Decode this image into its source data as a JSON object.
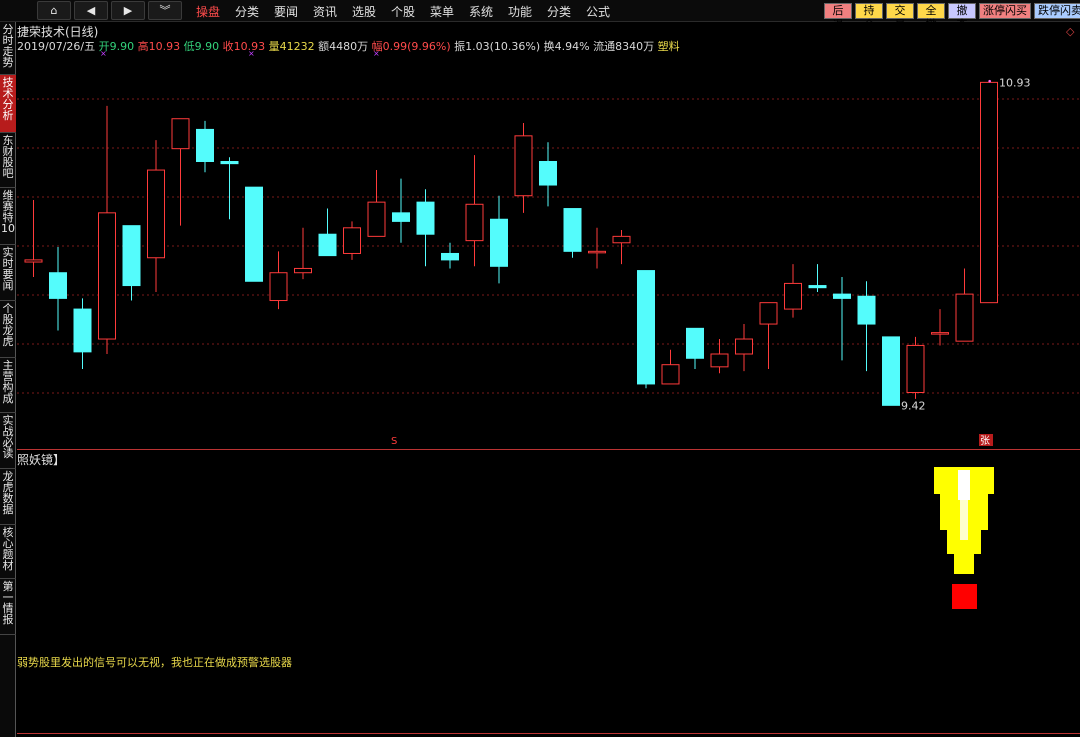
{
  "toolbar": {
    "nav_buttons": [
      {
        "name": "home",
        "glyph": "⌂"
      },
      {
        "name": "back",
        "glyph": "◀"
      },
      {
        "name": "forward",
        "glyph": "▶"
      },
      {
        "name": "expand",
        "glyph": "︾"
      }
    ],
    "menu": [
      "操盘",
      "分类",
      "要闻",
      "资讯",
      "选股",
      "个股",
      "菜单",
      "系统",
      "功能",
      "分类",
      "公式"
    ],
    "active_menu": 0,
    "actions": [
      {
        "label": "后退",
        "color": "#f08080"
      },
      {
        "label": "持仓",
        "color": "#ffd84a"
      },
      {
        "label": "交易",
        "color": "#ffd84a"
      },
      {
        "label": "全撤",
        "color": "#ffd84a"
      },
      {
        "label": "撤查",
        "color": "#c8c8ff"
      },
      {
        "label": "涨停闪买",
        "color": "#f08080"
      },
      {
        "label": "跌停闪卖",
        "color": "#aaccff"
      }
    ]
  },
  "side_tabs": [
    {
      "label": "分时走势",
      "active": false
    },
    {
      "label": "技术分析",
      "active": true
    },
    {
      "label": "东财股吧",
      "active": false
    },
    {
      "label": "维赛特10",
      "active": false
    },
    {
      "label": "实时要闻",
      "active": false
    },
    {
      "label": "个股龙虎",
      "active": false
    },
    {
      "label": "主营构成",
      "active": false
    },
    {
      "label": "实战必读",
      "active": false
    },
    {
      "label": "龙虎数据",
      "active": false
    },
    {
      "label": "核心题材",
      "active": false
    },
    {
      "label": "第一情报",
      "active": false
    }
  ],
  "info": {
    "title": "捷荣技术(日线)",
    "date": "2019/07/26/五",
    "open_label": "开",
    "open": "9.90",
    "high_label": "高",
    "high": "10.93",
    "low_label": "低",
    "low": "9.90",
    "close_label": "收",
    "close": "10.93",
    "volume_label": "量",
    "volume": "41232",
    "amount_label": "额",
    "amount": "4480万",
    "change_label": "幅",
    "change": "0.99(9.96%)",
    "amplitude_label": "振",
    "amplitude": "1.03(10.36%)",
    "turnover_label": "换",
    "turnover": "4.94%",
    "float_label": "流通",
    "float": "8340万",
    "tag": "塑料"
  },
  "indicator": {
    "label": "照妖镜】",
    "note": "弱势股里发出的信号可以无视，我也正在做成预警选股器"
  },
  "colors": {
    "up": "#ff3b3b",
    "down": "#54fcfc",
    "grid": "#7a1a1a",
    "signal_yellow": "#ffff00",
    "signal_red": "#ff0000"
  },
  "chart_data": {
    "type": "candlestick",
    "ylim": [
      9.3,
      11.1
    ],
    "max_label": "10.93",
    "min_label": "9.42",
    "marker_s": "S",
    "marker_zhang": "张",
    "candles": [
      {
        "o": 10.09,
        "h": 10.38,
        "l": 10.02,
        "c": 10.1
      },
      {
        "o": 10.04,
        "h": 10.16,
        "l": 9.77,
        "c": 9.92
      },
      {
        "o": 9.87,
        "h": 9.92,
        "l": 9.59,
        "c": 9.67
      },
      {
        "o": 9.73,
        "h": 10.82,
        "l": 9.66,
        "c": 10.32
      },
      {
        "o": 10.26,
        "h": 10.26,
        "l": 9.91,
        "c": 9.98
      },
      {
        "o": 10.11,
        "h": 10.66,
        "l": 9.95,
        "c": 10.52
      },
      {
        "o": 10.62,
        "h": 10.68,
        "l": 10.26,
        "c": 10.76
      },
      {
        "o": 10.71,
        "h": 10.75,
        "l": 10.51,
        "c": 10.56
      },
      {
        "o": 10.56,
        "h": 10.58,
        "l": 10.29,
        "c": 10.55
      },
      {
        "o": 10.44,
        "h": 10.44,
        "l": 10.0,
        "c": 10.0
      },
      {
        "o": 9.91,
        "h": 10.14,
        "l": 9.87,
        "c": 10.04
      },
      {
        "o": 10.04,
        "h": 10.25,
        "l": 10.01,
        "c": 10.06
      },
      {
        "o": 10.22,
        "h": 10.34,
        "l": 10.12,
        "c": 10.12
      },
      {
        "o": 10.13,
        "h": 10.28,
        "l": 10.1,
        "c": 10.25
      },
      {
        "o": 10.21,
        "h": 10.52,
        "l": 10.21,
        "c": 10.37
      },
      {
        "o": 10.32,
        "h": 10.48,
        "l": 10.18,
        "c": 10.28
      },
      {
        "o": 10.37,
        "h": 10.43,
        "l": 10.07,
        "c": 10.22
      },
      {
        "o": 10.13,
        "h": 10.18,
        "l": 10.06,
        "c": 10.1
      },
      {
        "o": 10.19,
        "h": 10.59,
        "l": 10.07,
        "c": 10.36
      },
      {
        "o": 10.29,
        "h": 10.4,
        "l": 9.99,
        "c": 10.07
      },
      {
        "o": 10.4,
        "h": 10.74,
        "l": 10.32,
        "c": 10.68
      },
      {
        "o": 10.56,
        "h": 10.65,
        "l": 10.35,
        "c": 10.45
      },
      {
        "o": 10.34,
        "h": 10.34,
        "l": 10.11,
        "c": 10.14
      },
      {
        "o": 10.14,
        "h": 10.25,
        "l": 10.06,
        "c": 10.14
      },
      {
        "o": 10.18,
        "h": 10.24,
        "l": 10.08,
        "c": 10.21
      },
      {
        "o": 10.05,
        "h": 10.05,
        "l": 9.5,
        "c": 9.52
      },
      {
        "o": 9.52,
        "h": 9.68,
        "l": 9.58,
        "c": 9.61
      },
      {
        "o": 9.78,
        "h": 9.78,
        "l": 9.59,
        "c": 9.64
      },
      {
        "o": 9.6,
        "h": 9.73,
        "l": 9.57,
        "c": 9.66
      },
      {
        "o": 9.66,
        "h": 9.8,
        "l": 9.58,
        "c": 9.73
      },
      {
        "o": 9.8,
        "h": 9.9,
        "l": 9.59,
        "c": 9.9
      },
      {
        "o": 9.87,
        "h": 10.08,
        "l": 9.83,
        "c": 9.99
      },
      {
        "o": 9.98,
        "h": 10.08,
        "l": 9.95,
        "c": 9.97
      },
      {
        "o": 9.94,
        "h": 10.02,
        "l": 9.63,
        "c": 9.92
      },
      {
        "o": 9.93,
        "h": 10.0,
        "l": 9.58,
        "c": 9.8
      },
      {
        "o": 9.74,
        "h": 9.74,
        "l": 9.42,
        "c": 9.42
      },
      {
        "o": 9.48,
        "h": 9.74,
        "l": 9.45,
        "c": 9.7
      },
      {
        "o": 9.76,
        "h": 9.87,
        "l": 9.7,
        "c": 9.76
      },
      {
        "o": 9.72,
        "h": 10.06,
        "l": 9.72,
        "c": 9.94
      },
      {
        "o": 9.9,
        "h": 10.93,
        "l": 9.9,
        "c": 10.93
      }
    ]
  }
}
